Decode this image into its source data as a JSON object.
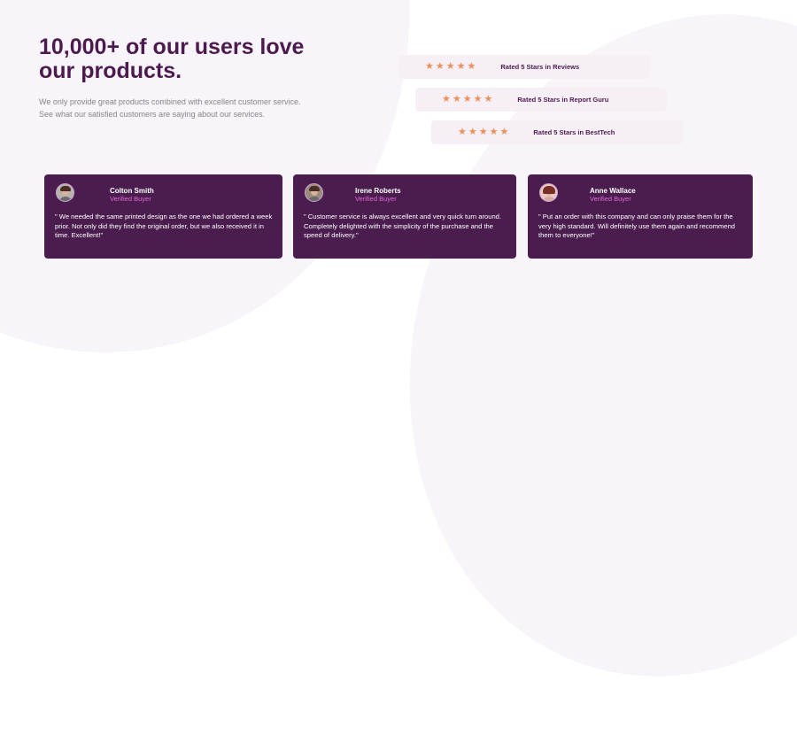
{
  "headline": "10,000+ of our users love our products.",
  "intro": "We only provide great products combined with excellent customer service. See what our satisfied customers are saying about our services.",
  "colors": {
    "heading": "#4d1a4f",
    "star": "#ee8f57",
    "card_bg": "#4b1d4f",
    "role_text": "#e26ad8",
    "rating_bg": "#f6f0f6"
  },
  "ratings": [
    {
      "stars": 5,
      "text": "Rated 5 Stars in Reviews"
    },
    {
      "stars": 5,
      "text": "Rated 5 Stars in Report Guru"
    },
    {
      "stars": 5,
      "text": "Rated 5 Stars in BestTech"
    }
  ],
  "testimonials": [
    {
      "name": "Colton Smith",
      "role": "Verified Buyer",
      "quote": "\" We needed the same printed design as the one we had ordered a week prior. Not only did they find the original order, but we also received it in time. Excellent!\""
    },
    {
      "name": "Irene Roberts",
      "role": "Verified Buyer",
      "quote": "\" Customer service is always excellent and very quick turn around. Completely delighted with the simplicity of the purchase and the speed of delivery.\""
    },
    {
      "name": "Anne Wallace",
      "role": "Verified Buyer",
      "quote": "\" Put an order with this company and can only praise them for the very high standard. Will definitely use them again and recommend them to everyone!\""
    }
  ]
}
